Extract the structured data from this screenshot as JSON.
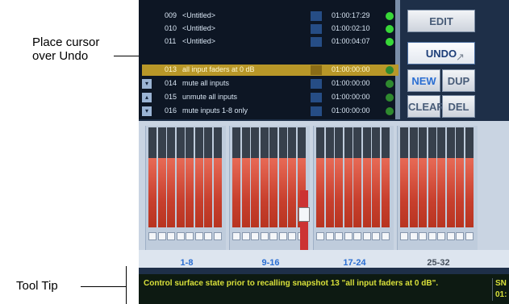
{
  "callouts": {
    "undo": "Place cursor\nover Undo",
    "tooltip": "Tool Tip"
  },
  "snapshots": [
    {
      "num": "009",
      "name": "<Untitled>",
      "time": "01:00:17:29",
      "indicator": "bright"
    },
    {
      "num": "010",
      "name": "<Untitled>",
      "time": "01:00:02:10",
      "indicator": "bright"
    },
    {
      "num": "011",
      "name": "<Untitled>",
      "time": "01:00:04:07",
      "indicator": "bright"
    },
    {
      "num": "013",
      "name": "all input faders at 0 dB",
      "time": "01:00:00:00",
      "indicator": "dim",
      "selected": true
    },
    {
      "num": "014",
      "name": "mute all inputs",
      "time": "01:00:00:00",
      "indicator": "dim"
    },
    {
      "num": "015",
      "name": "unmute all inputs",
      "time": "01:00:00:00",
      "indicator": "dim"
    },
    {
      "num": "016",
      "name": "mute inputs 1-8 only",
      "time": "01:00:00:00",
      "indicator": "dim"
    }
  ],
  "buttons": {
    "edit": "EDIT",
    "undo": "UNDO",
    "new": "NEW",
    "dup": "DUP",
    "clear": "CLEAR",
    "del": "DEL"
  },
  "banks": [
    "1-8",
    "9-16",
    "17-24",
    "25-32"
  ],
  "status": {
    "tooltip": "Control surface state prior to recalling snapshot 13 \"all input faders at 0 dB\".",
    "right": "SN 01:"
  },
  "colors": {
    "selected_row": "#b89728",
    "accent_blue": "#2a6ed2",
    "tooltip_text": "#d8e03a"
  }
}
